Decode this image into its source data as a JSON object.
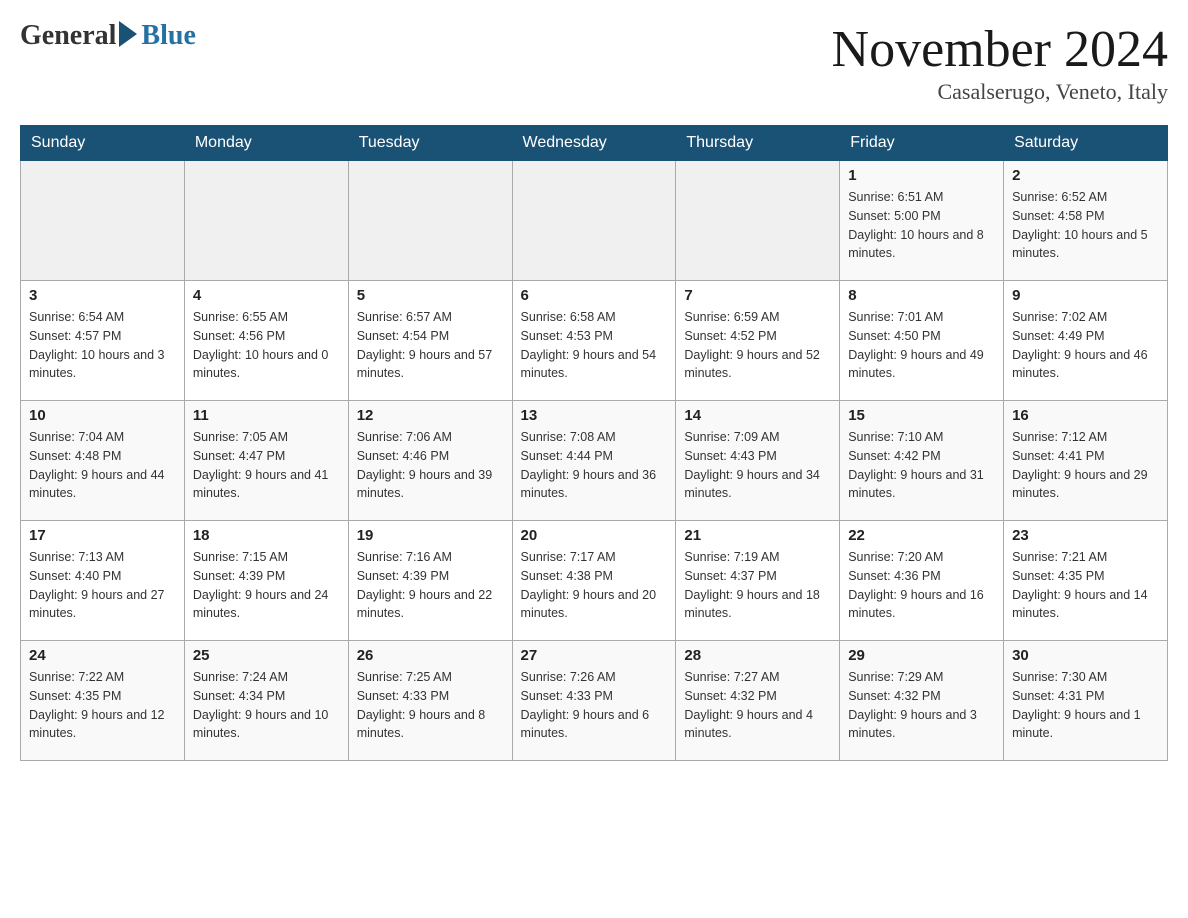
{
  "logo": {
    "general": "General",
    "blue": "Blue"
  },
  "title": "November 2024",
  "location": "Casalserugo, Veneto, Italy",
  "days_of_week": [
    "Sunday",
    "Monday",
    "Tuesday",
    "Wednesday",
    "Thursday",
    "Friday",
    "Saturday"
  ],
  "weeks": [
    [
      {
        "day": "",
        "info": ""
      },
      {
        "day": "",
        "info": ""
      },
      {
        "day": "",
        "info": ""
      },
      {
        "day": "",
        "info": ""
      },
      {
        "day": "",
        "info": ""
      },
      {
        "day": "1",
        "info": "Sunrise: 6:51 AM\nSunset: 5:00 PM\nDaylight: 10 hours and 8 minutes."
      },
      {
        "day": "2",
        "info": "Sunrise: 6:52 AM\nSunset: 4:58 PM\nDaylight: 10 hours and 5 minutes."
      }
    ],
    [
      {
        "day": "3",
        "info": "Sunrise: 6:54 AM\nSunset: 4:57 PM\nDaylight: 10 hours and 3 minutes."
      },
      {
        "day": "4",
        "info": "Sunrise: 6:55 AM\nSunset: 4:56 PM\nDaylight: 10 hours and 0 minutes."
      },
      {
        "day": "5",
        "info": "Sunrise: 6:57 AM\nSunset: 4:54 PM\nDaylight: 9 hours and 57 minutes."
      },
      {
        "day": "6",
        "info": "Sunrise: 6:58 AM\nSunset: 4:53 PM\nDaylight: 9 hours and 54 minutes."
      },
      {
        "day": "7",
        "info": "Sunrise: 6:59 AM\nSunset: 4:52 PM\nDaylight: 9 hours and 52 minutes."
      },
      {
        "day": "8",
        "info": "Sunrise: 7:01 AM\nSunset: 4:50 PM\nDaylight: 9 hours and 49 minutes."
      },
      {
        "day": "9",
        "info": "Sunrise: 7:02 AM\nSunset: 4:49 PM\nDaylight: 9 hours and 46 minutes."
      }
    ],
    [
      {
        "day": "10",
        "info": "Sunrise: 7:04 AM\nSunset: 4:48 PM\nDaylight: 9 hours and 44 minutes."
      },
      {
        "day": "11",
        "info": "Sunrise: 7:05 AM\nSunset: 4:47 PM\nDaylight: 9 hours and 41 minutes."
      },
      {
        "day": "12",
        "info": "Sunrise: 7:06 AM\nSunset: 4:46 PM\nDaylight: 9 hours and 39 minutes."
      },
      {
        "day": "13",
        "info": "Sunrise: 7:08 AM\nSunset: 4:44 PM\nDaylight: 9 hours and 36 minutes."
      },
      {
        "day": "14",
        "info": "Sunrise: 7:09 AM\nSunset: 4:43 PM\nDaylight: 9 hours and 34 minutes."
      },
      {
        "day": "15",
        "info": "Sunrise: 7:10 AM\nSunset: 4:42 PM\nDaylight: 9 hours and 31 minutes."
      },
      {
        "day": "16",
        "info": "Sunrise: 7:12 AM\nSunset: 4:41 PM\nDaylight: 9 hours and 29 minutes."
      }
    ],
    [
      {
        "day": "17",
        "info": "Sunrise: 7:13 AM\nSunset: 4:40 PM\nDaylight: 9 hours and 27 minutes."
      },
      {
        "day": "18",
        "info": "Sunrise: 7:15 AM\nSunset: 4:39 PM\nDaylight: 9 hours and 24 minutes."
      },
      {
        "day": "19",
        "info": "Sunrise: 7:16 AM\nSunset: 4:39 PM\nDaylight: 9 hours and 22 minutes."
      },
      {
        "day": "20",
        "info": "Sunrise: 7:17 AM\nSunset: 4:38 PM\nDaylight: 9 hours and 20 minutes."
      },
      {
        "day": "21",
        "info": "Sunrise: 7:19 AM\nSunset: 4:37 PM\nDaylight: 9 hours and 18 minutes."
      },
      {
        "day": "22",
        "info": "Sunrise: 7:20 AM\nSunset: 4:36 PM\nDaylight: 9 hours and 16 minutes."
      },
      {
        "day": "23",
        "info": "Sunrise: 7:21 AM\nSunset: 4:35 PM\nDaylight: 9 hours and 14 minutes."
      }
    ],
    [
      {
        "day": "24",
        "info": "Sunrise: 7:22 AM\nSunset: 4:35 PM\nDaylight: 9 hours and 12 minutes."
      },
      {
        "day": "25",
        "info": "Sunrise: 7:24 AM\nSunset: 4:34 PM\nDaylight: 9 hours and 10 minutes."
      },
      {
        "day": "26",
        "info": "Sunrise: 7:25 AM\nSunset: 4:33 PM\nDaylight: 9 hours and 8 minutes."
      },
      {
        "day": "27",
        "info": "Sunrise: 7:26 AM\nSunset: 4:33 PM\nDaylight: 9 hours and 6 minutes."
      },
      {
        "day": "28",
        "info": "Sunrise: 7:27 AM\nSunset: 4:32 PM\nDaylight: 9 hours and 4 minutes."
      },
      {
        "day": "29",
        "info": "Sunrise: 7:29 AM\nSunset: 4:32 PM\nDaylight: 9 hours and 3 minutes."
      },
      {
        "day": "30",
        "info": "Sunrise: 7:30 AM\nSunset: 4:31 PM\nDaylight: 9 hours and 1 minute."
      }
    ]
  ]
}
